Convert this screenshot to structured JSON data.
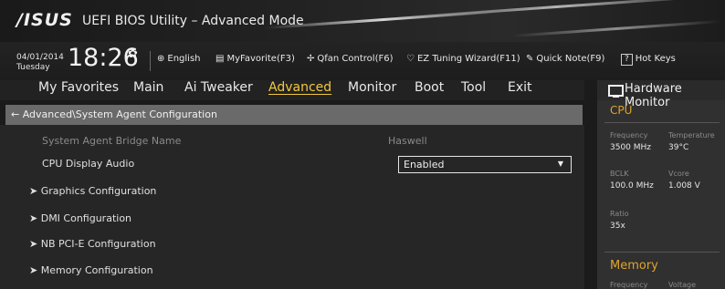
{
  "header": {
    "logo": "/ISUS",
    "title": "UEFI BIOS Utility – Advanced Mode"
  },
  "infobar": {
    "date": "04/01/2014",
    "day": "Tuesday",
    "time": "18:26",
    "tools": {
      "language": "English",
      "myfavorite": "MyFavorite(F3)",
      "qfan": "Qfan Control(F6)",
      "ez_tuning": "EZ Tuning Wizard(F11)",
      "quick_note": "Quick Note(F9)",
      "hot_keys": "Hot Keys",
      "hot_keys_box": "?"
    }
  },
  "menu": {
    "items": [
      "My Favorites",
      "Main",
      "Ai Tweaker",
      "Advanced",
      "Monitor",
      "Boot",
      "Tool",
      "Exit"
    ],
    "active": "Advanced"
  },
  "breadcrumb": "← Advanced\\System Agent Configuration",
  "content": {
    "bridge_label": "System Agent Bridge Name",
    "bridge_value": "Haswell",
    "audio_label": "CPU Display Audio",
    "audio_value": "Enabled",
    "submenus": [
      "Graphics Configuration",
      "DMI Configuration",
      "NB PCI-E Configuration",
      "Memory Configuration"
    ]
  },
  "hw_monitor": {
    "title": "Hardware Monitor",
    "cpu": {
      "section": "CPU",
      "frequency_label": "Frequency",
      "frequency_value": "3500 MHz",
      "temperature_label": "Temperature",
      "temperature_value": "39°C",
      "bclk_label": "BCLK",
      "bclk_value": "100.0 MHz",
      "vcore_label": "Vcore",
      "vcore_value": "1.008 V",
      "ratio_label": "Ratio",
      "ratio_value": "35x"
    },
    "memory": {
      "section": "Memory",
      "frequency_label": "Frequency",
      "voltage_label": "Voltage"
    }
  },
  "colors": {
    "accent": "#f3c93f",
    "section": "#e0a42c",
    "breadcrumb_bg": "#6a6a6a"
  }
}
